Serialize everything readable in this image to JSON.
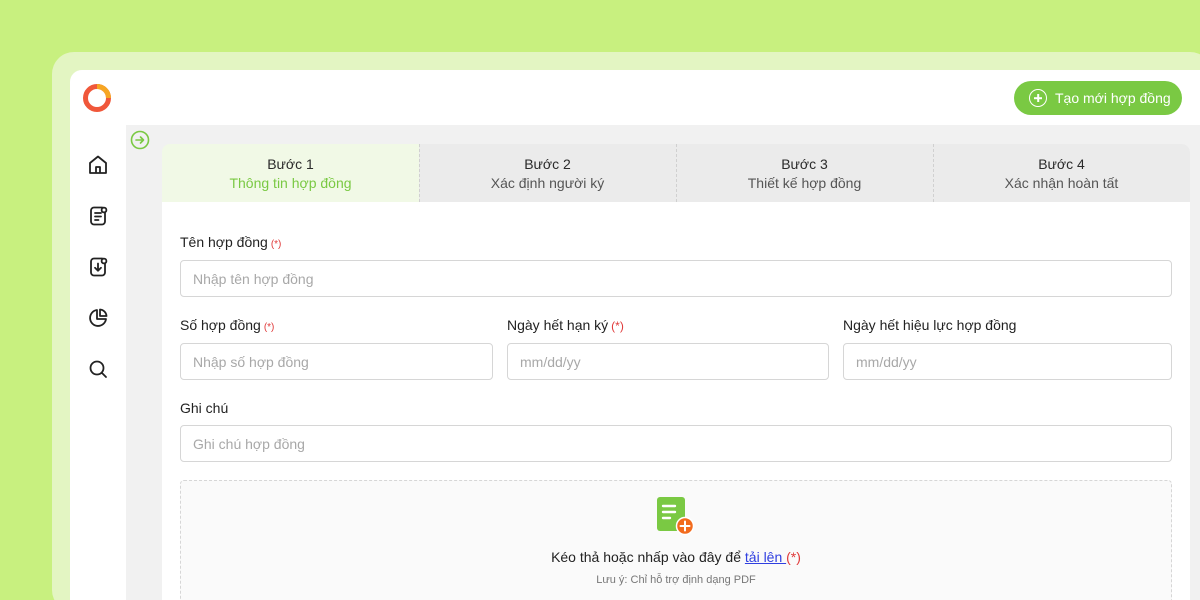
{
  "header": {
    "new_contract_label": "Tạo mới hợp đồng"
  },
  "sidebar": {
    "items": [
      {
        "icon": "home-icon"
      },
      {
        "icon": "document-list-icon"
      },
      {
        "icon": "document-download-icon"
      },
      {
        "icon": "pie-chart-icon"
      },
      {
        "icon": "search-icon"
      }
    ]
  },
  "steps": [
    {
      "number": "Bước 1",
      "title": "Thông tin hợp đồng",
      "active": true
    },
    {
      "number": "Bước 2",
      "title": "Xác định người ký",
      "active": false
    },
    {
      "number": "Bước 3",
      "title": "Thiết kế hợp đồng",
      "active": false
    },
    {
      "number": "Bước 4",
      "title": "Xác nhận hoàn tất",
      "active": false
    }
  ],
  "form": {
    "contract_name": {
      "label": "Tên hợp đồng",
      "required": "(*)",
      "placeholder": "Nhập tên hợp đồng"
    },
    "contract_number": {
      "label": "Số hợp đồng",
      "required": "(*)",
      "placeholder": "Nhập số hợp đồng"
    },
    "signing_deadline": {
      "label": "Ngày hết hạn ký",
      "required": "(*)",
      "placeholder": "mm/dd/yy"
    },
    "expiry_date": {
      "label": "Ngày hết hiệu lực hợp đồng",
      "placeholder": "mm/dd/yy"
    },
    "note": {
      "label": "Ghi chú",
      "placeholder": "Ghi chú hợp đồng"
    }
  },
  "upload": {
    "text_before": "Kéo thả hoặc nhấp vào đây để ",
    "link": "tải lên ",
    "required": "(*)",
    "note": "Lưu ý: Chỉ hỗ trợ định dạng PDF"
  },
  "colors": {
    "accent": "#7ac943",
    "background": "#c8f07f",
    "required": "#e03a3a",
    "link": "#2f3fe0"
  }
}
